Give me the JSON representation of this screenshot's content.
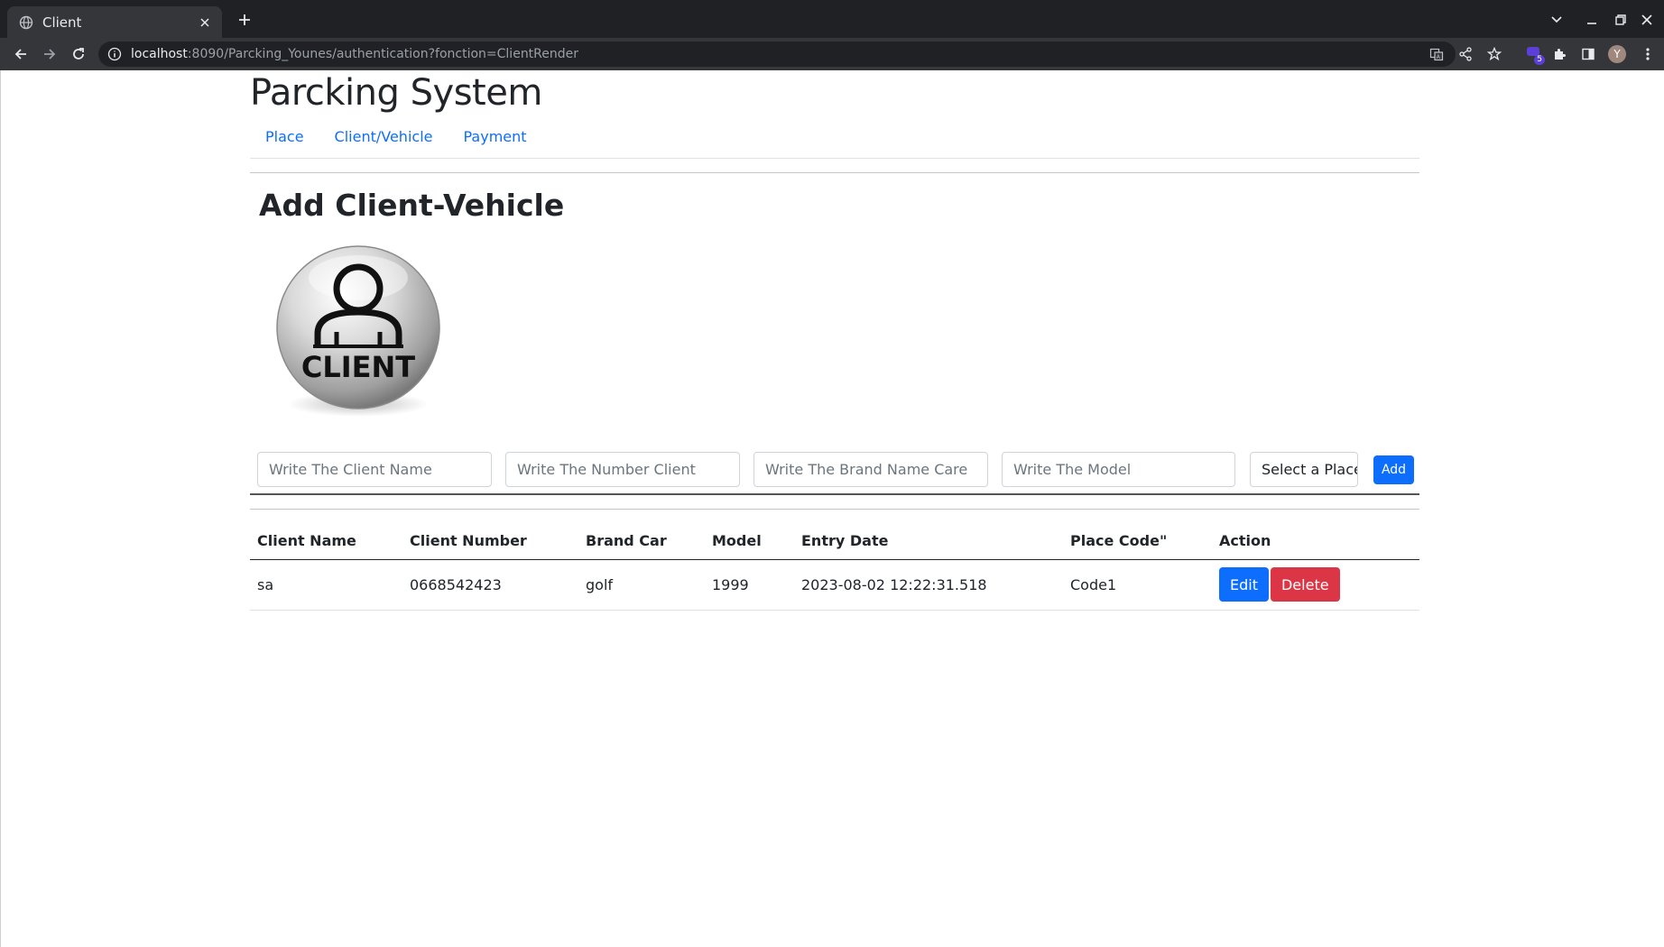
{
  "browser": {
    "tab_title": "Client",
    "url_host": "localhost",
    "url_rest": ":8090/Parcking_Younes/authentication?fonction=ClientRender",
    "profile_initial": "Y",
    "extension_badge": "5"
  },
  "header": {
    "brand": "Parcking System",
    "nav": [
      "Place",
      "Client/Vehicle",
      "Payment"
    ]
  },
  "main": {
    "heading": "Add Client-Vehicle",
    "image_text": "CLIENT",
    "form": {
      "client_name_placeholder": "Write The Client Name",
      "client_number_placeholder": "Write The Number Client",
      "brand_placeholder": "Write The Brand Name Care",
      "model_placeholder": "Write The Model",
      "place_select": "Select a Place",
      "add_label": "Add"
    },
    "table": {
      "columns": [
        "Client Name",
        "Client Number",
        "Brand Car",
        "Model",
        "Entry Date",
        "Place Code\"",
        "Action"
      ],
      "rows": [
        {
          "client_name": "sa",
          "client_number": "0668542423",
          "brand": "golf",
          "model": "1999",
          "entry_date": "2023-08-02 12:22:31.518",
          "place_code": "Code1",
          "edit": "Edit",
          "delete": "Delete"
        }
      ]
    }
  },
  "colors": {
    "primary": "#0d6efd",
    "danger": "#dc3545",
    "chrome_dark": "#202124",
    "chrome_toolbar": "#35363a"
  }
}
